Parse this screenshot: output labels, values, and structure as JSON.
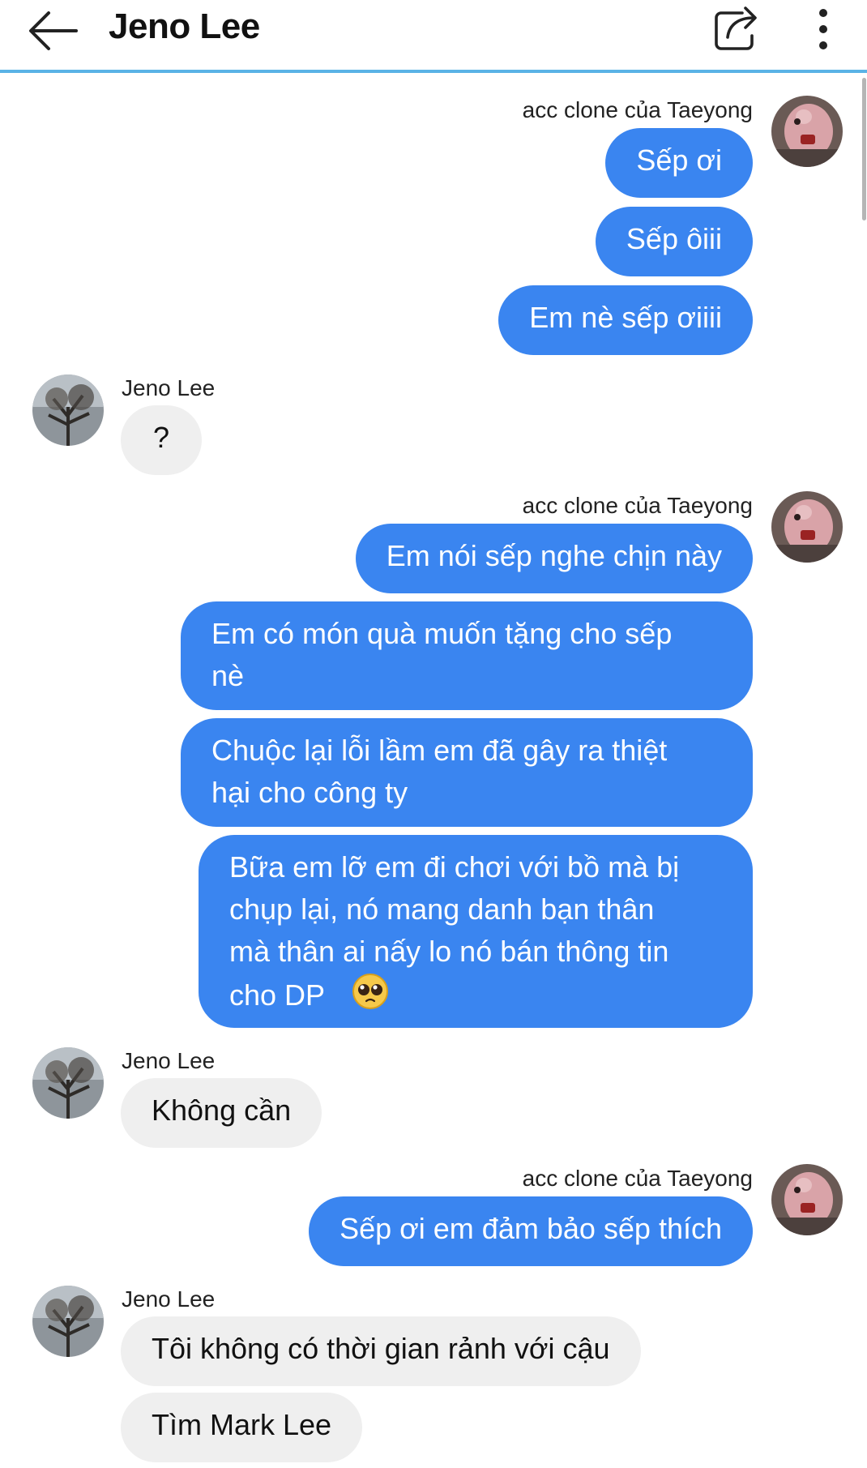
{
  "header": {
    "title": "Jeno Lee",
    "back_icon": "arrow-left-icon",
    "share_icon": "share-icon",
    "more_icon": "more-vertical-icon",
    "accent": "#5ab3e6"
  },
  "colors": {
    "outgoing_bubble": "#3a85f0",
    "incoming_bubble": "#efefef"
  },
  "messages": {
    "group1": {
      "sender": "acc clone của Taeyong",
      "m1": "Sếp ơi",
      "m2": "Sếp ôiii",
      "m3": "Em nè sếp ơiiii"
    },
    "group2": {
      "sender": "Jeno Lee",
      "m1": "?"
    },
    "group3": {
      "sender": "acc clone của Taeyong",
      "m1": "Em nói sếp nghe chịn này",
      "m2_line1": "Em có món quà muốn tặng cho sếp",
      "m2_line2": "nè",
      "m3_line1": "Chuộc lại lỗi lầm em đã gây ra thiệt",
      "m3_line2": "hại cho công ty",
      "m4_line1": "Bữa em lỡ em đi chơi với bồ mà bị",
      "m4_line2": "chụp lại, nó mang danh bạn thân",
      "m4_line3": "mà thân ai nấy lo nó bán thông tin",
      "m4_line4": "cho DP",
      "m4_emoji": "pleading-face-emoji"
    },
    "group4": {
      "sender": "Jeno Lee",
      "m1": "Không cần"
    },
    "group5": {
      "sender": "acc clone của Taeyong",
      "m1": "Sếp ơi em đảm bảo sếp thích"
    },
    "group6": {
      "sender": "Jeno Lee",
      "m1": "Tôi không có thời gian rảnh với cậu",
      "m2": "Tìm Mark Lee"
    }
  }
}
